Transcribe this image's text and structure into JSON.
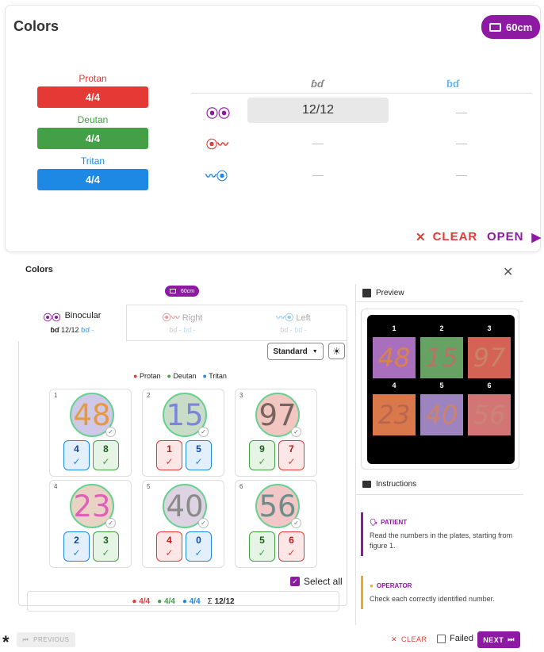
{
  "top": {
    "title": "Colors",
    "distance": "60cm",
    "scores": [
      {
        "label": "Protan",
        "value": "4/4",
        "color": "#e53935"
      },
      {
        "label": "Deutan",
        "value": "4/4",
        "color": "#43a047"
      },
      {
        "label": "Tritan",
        "value": "4/4",
        "color": "#1e88e5"
      }
    ],
    "grid": {
      "both": "12/12",
      "dash": "—"
    },
    "clear": "CLEAR",
    "open": "OPEN"
  },
  "dialog": {
    "title": "Colors",
    "distance": "60cm",
    "tabs": [
      {
        "label": "Binocular",
        "score": "12/12",
        "dash": "-"
      },
      {
        "label": "Right",
        "dash": "-"
      },
      {
        "label": "Left",
        "dash": "-"
      }
    ],
    "mode": "Standard",
    "legend": [
      "Protan",
      "Deutan",
      "Tritan"
    ],
    "plates": [
      {
        "n": "1",
        "value": "48",
        "d": [
          "4",
          "8"
        ]
      },
      {
        "n": "2",
        "value": "15",
        "d": [
          "1",
          "5"
        ]
      },
      {
        "n": "3",
        "value": "97",
        "d": [
          "9",
          "7"
        ]
      },
      {
        "n": "4",
        "value": "23",
        "d": [
          "2",
          "3"
        ]
      },
      {
        "n": "5",
        "value": "40",
        "d": [
          "4",
          "0"
        ]
      },
      {
        "n": "6",
        "value": "56",
        "d": [
          "5",
          "6"
        ]
      }
    ],
    "select_all": "Select all",
    "summary": {
      "protan": "4/4",
      "deutan": "4/4",
      "tritan": "4/4",
      "sigma": "Σ",
      "total": "12/12"
    },
    "preview": {
      "title": "Preview",
      "nums": [
        "1",
        "2",
        "3",
        "4",
        "5",
        "6"
      ],
      "vals": [
        "48",
        "15",
        "97",
        "23",
        "40",
        "56"
      ]
    },
    "instructions": {
      "title": "Instructions",
      "patient_h": "PATIENT",
      "patient": "Read the numbers in the plates, starting from figure 1.",
      "operator_h": "OPERATOR",
      "operator": "Check each correctly identified number."
    },
    "footer": {
      "previous": "PREVIOUS",
      "clear": "CLEAR",
      "failed": "Failed",
      "next": "NEXT"
    }
  }
}
